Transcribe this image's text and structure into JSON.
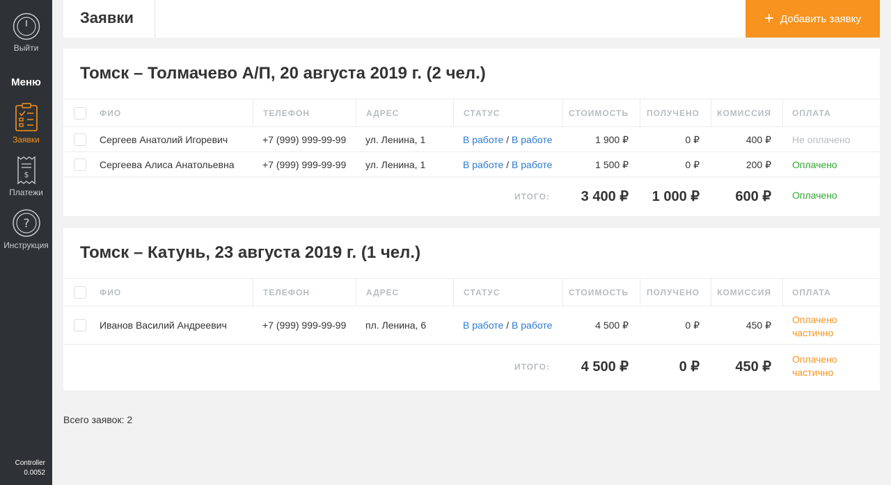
{
  "sidebar": {
    "logout_label": "Выйти",
    "menu_title": "Меню",
    "items": [
      {
        "label": "Заявки",
        "icon": "clipboard-icon",
        "active": true
      },
      {
        "label": "Платежи",
        "icon": "receipt-icon",
        "active": false
      },
      {
        "label": "Инструкция",
        "icon": "question-icon",
        "active": false
      }
    ],
    "footer_app": "Controller",
    "footer_version": "0.0052"
  },
  "header": {
    "title": "Заявки",
    "add_button_label": "Добавить заявку"
  },
  "columns": [
    "ФИО",
    "ТЕЛЕФОН",
    "АДРЕС",
    "СТАТУС",
    "СТОИМОСТЬ",
    "ПОЛУЧЕНО",
    "КОМИССИЯ",
    "ОПЛАТА"
  ],
  "total_label": "ИТОГО:",
  "status_sep": "/",
  "groups": [
    {
      "title": "Томск – Толмачево А/П, 20 августа 2019 г. (2 чел.)",
      "rows": [
        {
          "name": "Сергеев Анатолий Игоревич",
          "phone": "+7 (999) 999-99-99",
          "address": "ул. Ленина, 1",
          "status1": "В работе",
          "status2": "В работе",
          "cost": "1 900 ₽",
          "received": "0 ₽",
          "commission": "400 ₽",
          "payment": "Не оплачено"
        },
        {
          "name": "Сергеева Алиса Анатольевна",
          "phone": "+7 (999) 999-99-99",
          "address": "ул. Ленина, 1",
          "status1": "В работе",
          "status2": "В работе",
          "cost": "1 500 ₽",
          "received": "0 ₽",
          "commission": "200 ₽",
          "payment": "Оплачено"
        }
      ],
      "totals": {
        "cost": "3 400 ₽",
        "received": "1 000 ₽",
        "commission": "600 ₽",
        "payment": "Оплачено"
      }
    },
    {
      "title": "Томск – Катунь, 23 августа 2019 г. (1 чел.)",
      "rows": [
        {
          "name": "Иванов Василий Андреевич",
          "phone": "+7 (999) 999-99-99",
          "address": "пл. Ленина, 6",
          "status1": "В работе",
          "status2": "В работе",
          "cost": "4 500 ₽",
          "received": "0 ₽",
          "commission": "450 ₽",
          "payment_line1": "Оплачено",
          "payment_line2": "частично"
        }
      ],
      "totals": {
        "cost": "4 500 ₽",
        "received": "0 ₽",
        "commission": "450 ₽",
        "payment_line1": "Оплачено",
        "payment_line2": "частично"
      }
    }
  ],
  "footer": {
    "total_requests": "Всего заявок: 2"
  },
  "colors": {
    "accent": "#f7931e",
    "link": "#2a7ad1",
    "paid": "#2ea82e",
    "unpaid": "#b8bcc0",
    "sidebar": "#2e3236"
  }
}
